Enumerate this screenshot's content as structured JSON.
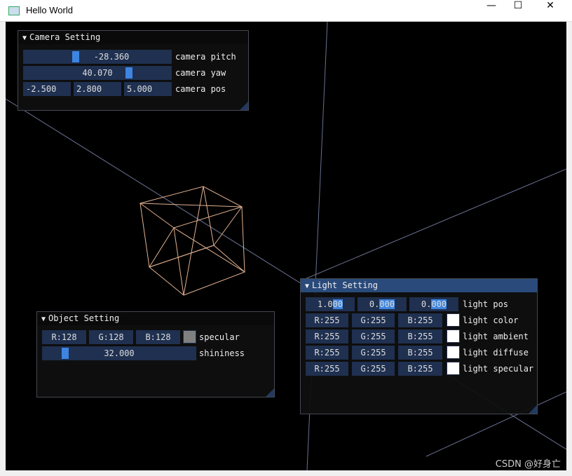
{
  "window": {
    "title": "Hello World",
    "minimize": "—",
    "maximize": "☐",
    "close": "✕"
  },
  "camera": {
    "title": "Camera Setting",
    "pitch_value": "-28.360",
    "pitch_label": "camera pitch",
    "pitch_fraction": 0.33,
    "yaw_value": "40.070",
    "yaw_label": "camera yaw",
    "yaw_fraction": 0.7,
    "pos": [
      "-2.500",
      "2.800",
      "5.000"
    ],
    "pos_label": "camera pos"
  },
  "object": {
    "title": "Object Setting",
    "specular": [
      "R:128",
      "G:128",
      "B:128"
    ],
    "specular_label": "specular",
    "specular_color": "#808080",
    "shininess_value": "32.000",
    "shininess_label": "shininess",
    "shininess_fraction": 0.13
  },
  "light": {
    "title": "Light Setting",
    "pos": [
      {
        "a": "1.0",
        "b": "00"
      },
      {
        "a": "0.",
        "b": "000"
      },
      {
        "a": "0.",
        "b": "000"
      }
    ],
    "pos_label": "light pos",
    "rows": [
      {
        "r": "R:255",
        "g": "G:255",
        "b": "B:255",
        "label": "light color",
        "color": "#ffffff"
      },
      {
        "r": "R:255",
        "g": "G:255",
        "b": "B:255",
        "label": "light ambient",
        "color": "#ffffff"
      },
      {
        "r": "R:255",
        "g": "G:255",
        "b": "B:255",
        "label": "light diffuse",
        "color": "#ffffff"
      },
      {
        "r": "R:255",
        "g": "G:255",
        "b": "B:255",
        "label": "light specular",
        "color": "#ffffff"
      }
    ]
  },
  "watermark": "CSDN @好身亡",
  "colors": {
    "cube": "#e0b090",
    "axis": "#6a7090",
    "widget": "#1f3050",
    "grab": "#3d85e0",
    "header_active": "#294a7a"
  }
}
